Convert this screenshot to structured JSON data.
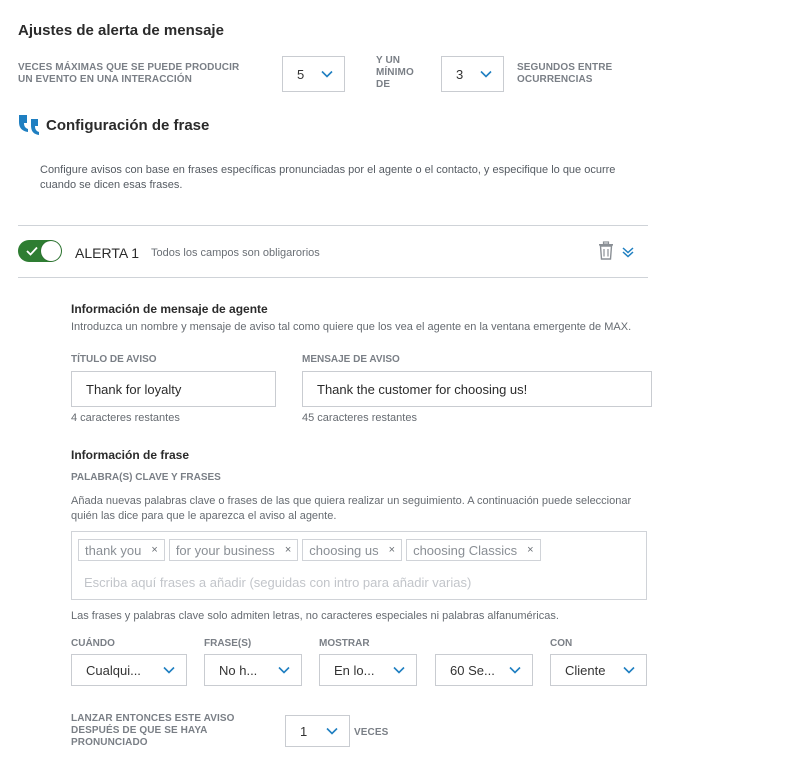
{
  "alert_settings": {
    "title": "Ajustes de alerta de mensaje",
    "max_times_label": "VECES MÁXIMAS QUE SE PUEDE PRODUCIR UN EVENTO EN UNA INTERACCIÓN",
    "max_times_value": "5",
    "min_label": "Y UN MÍNIMO DE",
    "min_value": "3",
    "seconds_label": "SEGUNDOS ENTRE OCURRENCIAS"
  },
  "phrase_config": {
    "icon": "quote-icon",
    "title": "Configuración de frase",
    "description": "Configure avisos con base en frases específicas pronunciadas por el agente o el contacto, y especifique lo que ocurre cuando se dicen esas frases."
  },
  "alert": {
    "enabled": true,
    "name": "ALERTA 1",
    "required_note": "Todos los campos son obligarorios",
    "agent_info": {
      "heading": "Información de mensaje de agente",
      "description": "Introduzca un nombre y mensaje de aviso tal como quiere que los vea el agente en la ventana emergente de MAX.",
      "title_label": "TÍTULO DE AVISO",
      "title_value": "Thank for loyalty",
      "title_remaining": "4 caracteres restantes",
      "message_label": "MENSAJE DE AVISO",
      "message_value": "Thank the customer for choosing us!",
      "message_remaining": "45 caracteres restantes"
    },
    "phrase_info": {
      "heading": "Información de frase",
      "keywords_label": "PALABRA(S) CLAVE Y FRASES",
      "description": "Añada nuevas palabras clave o frases de las que quiera realizar un seguimiento. A continuación puede seleccionar quién las dice para que le aparezca el aviso al agente.",
      "tags": [
        "thank you",
        "for your business",
        "choosing us",
        "choosing Classics"
      ],
      "input_placeholder": "Escriba aquí frases a añadir (seguidas con intro para añadir varias)",
      "note": "Las frases y palabras clave solo admiten letras, no caracteres especiales ni palabras alfanuméricas."
    },
    "conditions": {
      "when_label": "CUÁNDO",
      "when_value": "Cualqui...",
      "phrases_label": "FRASE(S)",
      "phrases_value": "No h...",
      "show_label": "MOSTRAR",
      "show_value": "En lo...",
      "time_value": "60 Se...",
      "with_label": "CON",
      "with_value": "Cliente"
    },
    "trigger": {
      "label": "LANZAR ENTONCES ESTE AVISO DESPUÉS DE QUE SE HAYA PRONUNCIADO",
      "value": "1",
      "suffix": "VECES"
    }
  },
  "colors": {
    "accent_blue": "#1f7fc1",
    "toggle_green": "#2e7d32"
  }
}
